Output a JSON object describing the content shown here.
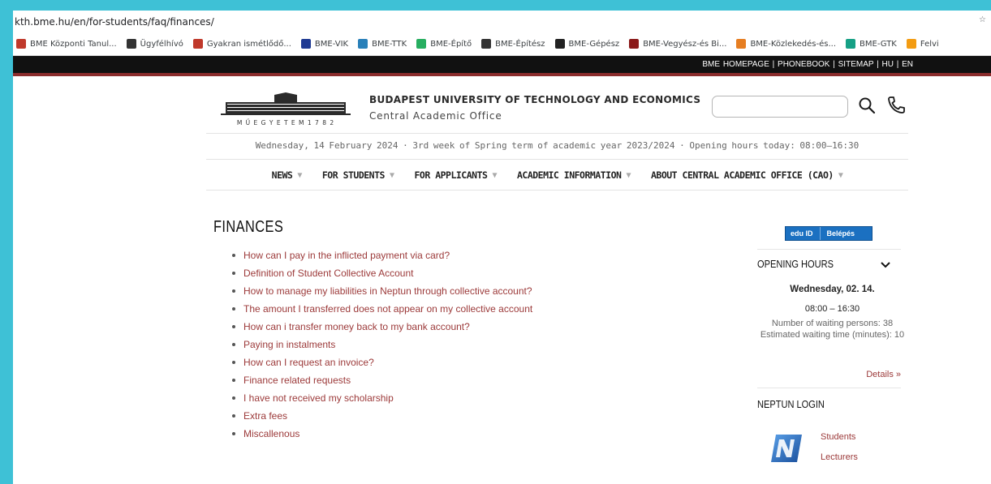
{
  "browser": {
    "url": "kth.bme.hu/en/for-students/faq/finances/",
    "bookmarks": [
      {
        "label": "BME Központi Tanul...",
        "color": "#c0392b"
      },
      {
        "label": "Ügyfélhívó",
        "color": "#333333"
      },
      {
        "label": "Gyakran ismétlődő...",
        "color": "#c0392b"
      },
      {
        "label": "BME-VIK",
        "color": "#1f3a93"
      },
      {
        "label": "BME-TTK",
        "color": "#2980b9"
      },
      {
        "label": "BME-Építő",
        "color": "#27ae60"
      },
      {
        "label": "BME-Építész",
        "color": "#333333"
      },
      {
        "label": "BME-Gépész",
        "color": "#222222"
      },
      {
        "label": "BME-Vegyész-és Bi...",
        "color": "#8b1a1a"
      },
      {
        "label": "BME-Közlekedés-és...",
        "color": "#e67e22"
      },
      {
        "label": "BME-GTK",
        "color": "#16a085"
      },
      {
        "label": "Felvi",
        "color": "#f39c12"
      }
    ]
  },
  "topbar": {
    "links": "BME HOMEPAGE | PHONEBOOK | SITEMAP | HU | EN"
  },
  "header": {
    "logo_text": "M Ű E G Y E T E M   1 7 8 2",
    "university": "BUDAPEST UNIVERSITY OF TECHNOLOGY AND ECONOMICS",
    "office": "Central Academic Office",
    "search_placeholder": ""
  },
  "dateline": "Wednesday, 14 February 2024  ·  3rd week of Spring term of academic year 2023/2024  ·  Opening hours today: 08:00–16:30",
  "nav": [
    {
      "label": "NEWS"
    },
    {
      "label": "FOR STUDENTS"
    },
    {
      "label": "FOR APPLICANTS"
    },
    {
      "label": "ACADEMIC INFORMATION"
    },
    {
      "label": "ABOUT CENTRAL ACADEMIC OFFICE (CAO)"
    }
  ],
  "main": {
    "title": "FINANCES",
    "links": [
      "How can I pay in the inflicted payment via card?",
      "Definition of Student Collective Account",
      "How to manage my liabilities in Neptun through collective account?",
      "The amount I transferred does not appear on my collective account",
      "How can i transfer money back to my bank account?",
      "Paying in instalments",
      "How can I request an invoice?",
      "Finance related requests",
      "I have not received my scholarship",
      "Extra fees",
      "Miscallenous"
    ]
  },
  "sidebar": {
    "eduid_brand": "edu ID",
    "eduid_login": "Belépés",
    "opening_hours_title": "OPENING HOURS",
    "date": "Wednesday, 02. 14.",
    "hours": "08:00 – 16:30",
    "waiting": "Number of waiting persons: 38 Estimated waiting time (minutes): 10",
    "details": "Details »",
    "neptun_title": "NEPTUN LOGIN",
    "students": "Students",
    "lecturers": "Lecturers"
  }
}
